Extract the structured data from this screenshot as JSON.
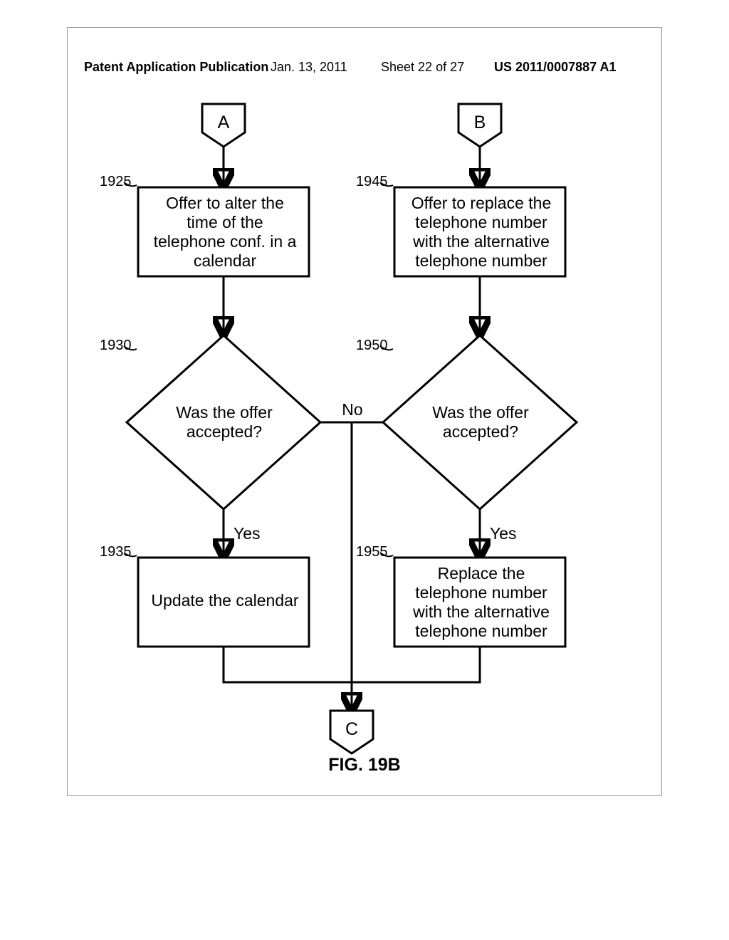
{
  "header": {
    "left": "Patent Application Publication",
    "date": "Jan. 13, 2011",
    "sheet": "Sheet 22 of 27",
    "pubno": "US 2011/0007887 A1"
  },
  "connectors": {
    "A": "A",
    "B": "B",
    "C": "C"
  },
  "refs": {
    "r1925": "1925",
    "r1930": "1930",
    "r1935": "1935",
    "r1945": "1945",
    "r1950": "1950",
    "r1955": "1955"
  },
  "boxes": {
    "b1925": "Offer to alter the\ntime of the\ntelephone conf. in a\ncalendar",
    "b1945": "Offer to replace the\ntelephone number\nwith the alternative\ntelephone number",
    "d1930": "Was the offer\naccepted?",
    "d1950": "Was the offer\naccepted?",
    "b1935": "Update the calendar",
    "b1955": "Replace the\ntelephone number\nwith the alternative\ntelephone number"
  },
  "edges": {
    "no": "No",
    "yesL": "Yes",
    "yesR": "Yes"
  },
  "caption": "FIG. 19B"
}
